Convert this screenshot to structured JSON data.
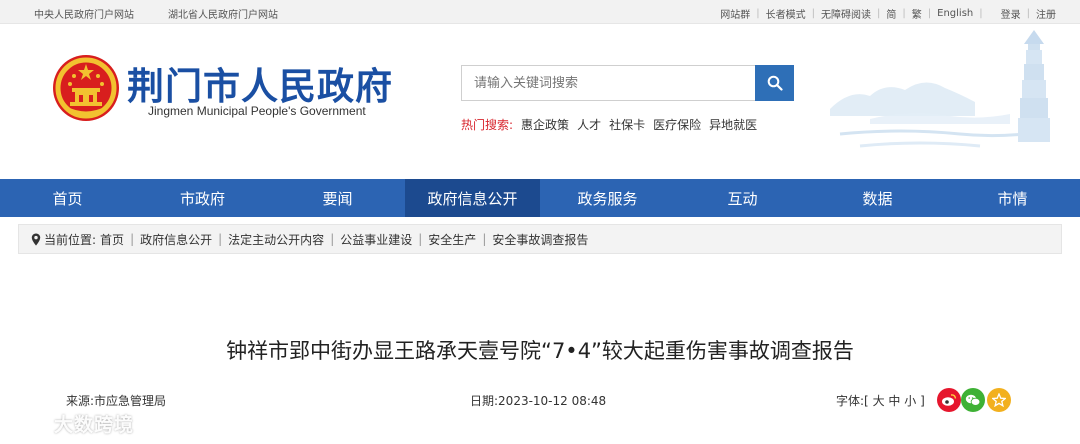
{
  "topbar": {
    "left_links": [
      "中央人民政府门户网站",
      "湖北省人民政府门户网站"
    ],
    "right_links_a": [
      "网站群",
      "长者模式",
      "无障碍阅读",
      "简",
      "繁",
      "English"
    ],
    "right_links_b": [
      "登录",
      "注册"
    ]
  },
  "header": {
    "title_cn": "荆门市人民政府",
    "title_en": "Jingmen Municipal People's Government",
    "search_placeholder": "请输入关键词搜索",
    "hot_label": "热门搜索:",
    "hot_keywords": [
      "惠企政策",
      "人才",
      "社保卡",
      "医疗保险",
      "异地就医"
    ]
  },
  "nav": {
    "items": [
      "首页",
      "市政府",
      "要闻",
      "政府信息公开",
      "政务服务",
      "互动",
      "数据",
      "市情"
    ],
    "active_index": 3
  },
  "breadcrumb": {
    "label": "当前位置:",
    "items": [
      "首页",
      "政府信息公开",
      "法定主动公开内容",
      "公益事业建设",
      "安全生产",
      "安全事故调查报告"
    ]
  },
  "article": {
    "title": "钟祥市郢中街办显王路承天壹号院“7•4”较大起重伤害事故调查报告",
    "source": "来源:市应急管理局",
    "date": "日期:2023-10-12 08:48",
    "font_label": "字体:[",
    "font_sizes": [
      "大",
      "中",
      "小"
    ],
    "font_close": "]"
  },
  "watermark": {
    "text": "大数跨境"
  },
  "colors": {
    "nav": "#2c64b3",
    "nav_active": "#1c4a8f",
    "brand": "#1a4fa3",
    "hot": "#d8262e"
  }
}
